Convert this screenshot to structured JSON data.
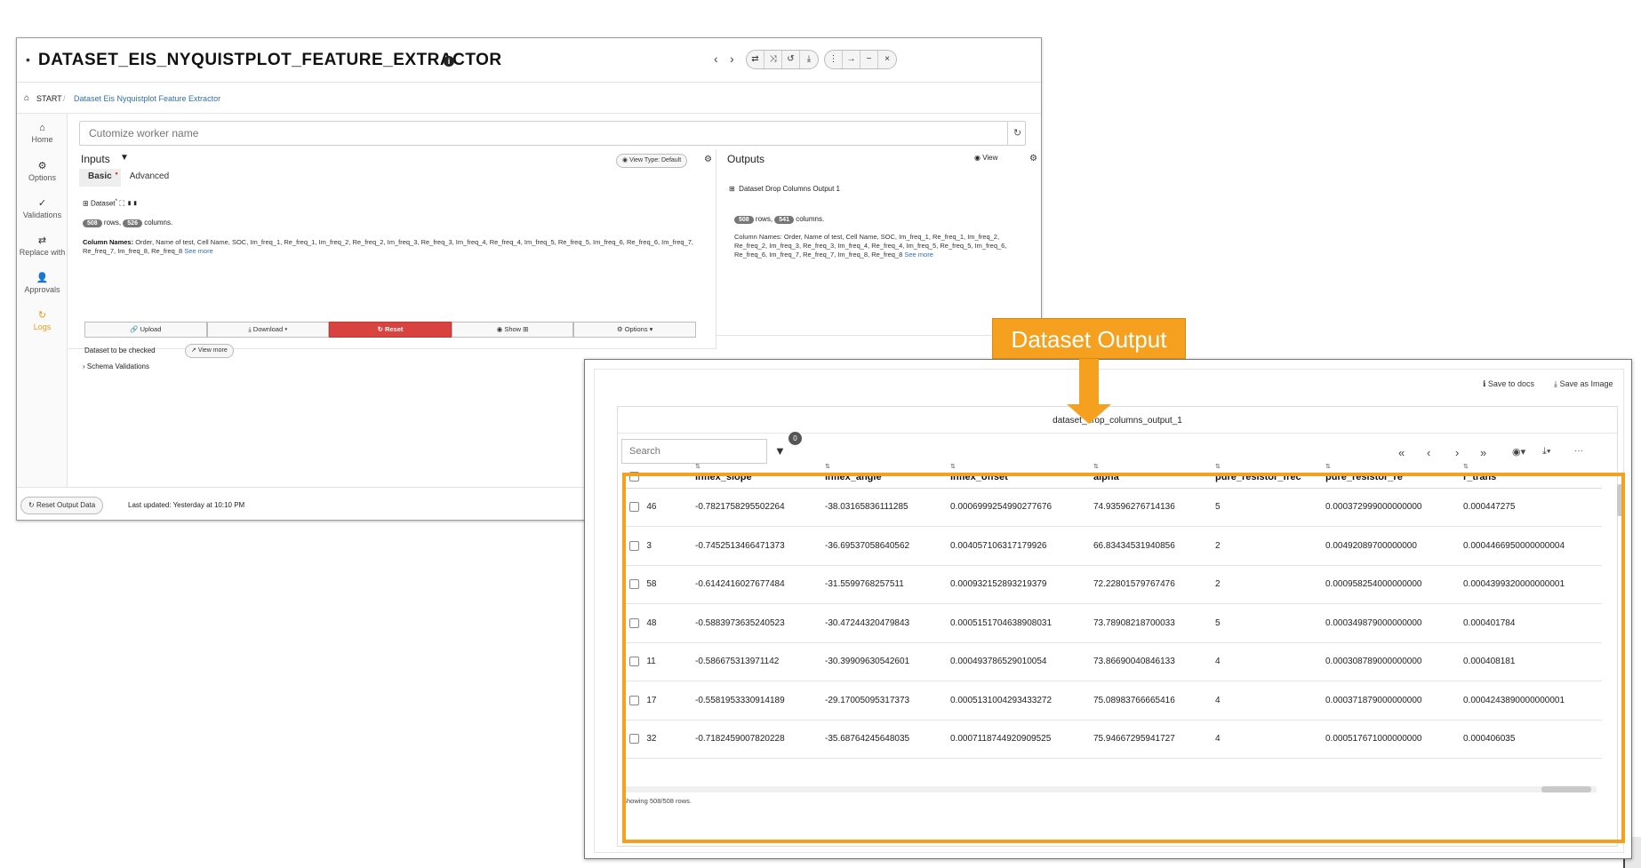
{
  "window": {
    "title": "DATASET_EIS_NYQUISTPLOT_FEATURE_EXTRACTOR",
    "nav_back": "‹",
    "nav_forward": "›"
  },
  "breadcrumb": {
    "start": "START",
    "separator": "/",
    "current": "Dataset Eis Nyquistplot Feature Extractor"
  },
  "sidebar": {
    "items": [
      {
        "label": "Home",
        "icon": "home-icon"
      },
      {
        "label": "Options",
        "icon": "gear-icon"
      },
      {
        "label": "Validations",
        "icon": "validations-icon"
      },
      {
        "label": "Replace with",
        "icon": "swap-icon"
      },
      {
        "label": "Approvals",
        "icon": "approvals-icon"
      },
      {
        "label": "Logs",
        "icon": "history-icon"
      }
    ]
  },
  "worker": {
    "placeholder": "Cutomize worker name"
  },
  "inputs": {
    "title": "Inputs",
    "view_type": "View Type: Default",
    "tabs": {
      "basic": "Basic",
      "advanced": "Advanced"
    },
    "dataset_label": "Dataset",
    "rows_count": "508",
    "rows_label": "rows,",
    "cols_count": "526",
    "cols_label": "columns.",
    "colnames_label": "Column Names:",
    "colnames_text": "Order, Name of test, Cell Name, SOC, Im_freq_1, Re_freq_1, Im_freq_2, Re_freq_2, Im_freq_3, Re_freq_3, Im_freq_4, Re_freq_4, Im_freq_5, Re_freq_5, Im_freq_6, Re_freq_6, Im_freq_7, Re_freq_7, Im_freq_8, Re_freq_8",
    "see_more": "See more",
    "actions": {
      "upload": "Upload",
      "download": "Download ▾",
      "reset": "Reset",
      "show": "Show",
      "options": "Options ▾"
    },
    "to_check": "Dataset to be checked",
    "view_more": "View more",
    "schema": "Schema Validations"
  },
  "outputs": {
    "title": "Outputs",
    "view": "View",
    "output_name": "Dataset Drop Columns Output 1",
    "rows_count": "508",
    "rows_label": "rows,",
    "cols_count": "541",
    "cols_label": "columns.",
    "colnames_label": "Column Names:",
    "colnames_text": "Order, Name of test, Cell Name, SOC, Im_freq_1, Re_freq_1, Im_freq_2, Re_freq_2, Im_freq_3, Re_freq_3, Im_freq_4, Re_freq_4, Im_freq_5, Re_freq_5, Im_freq_6, Re_freq_6, Im_freq_7, Re_freq_7, Im_freq_8, Re_freq_8",
    "see_more": "See more"
  },
  "footer": {
    "reset_output": "Reset Output Data",
    "updated": "Last updated: Yesterday at 10:10 PM"
  },
  "annotation": {
    "label": "Dataset Output"
  },
  "output_view": {
    "save_docs": "Save to docs",
    "save_image": "Save as Image",
    "table_title": "dataset_drop_columns_output_1",
    "search_placeholder": "Search",
    "filter_count": "0",
    "pager": {
      "first": "«",
      "prev": "‹",
      "next": "›",
      "last": "»",
      "more": "···"
    },
    "columns": [
      "inflex_slope",
      "inflex_angle",
      "inflex_offset",
      "alpha",
      "pure_resistor_frec",
      "pure_resistor_re",
      "r_trans"
    ],
    "rows": [
      {
        "id": "46",
        "cells": [
          "-0.7821758295502264",
          "-38.03165836111285",
          "0.0006999254990277676",
          "74.93596276714136",
          "5",
          "0.000372999000000000",
          "0.000447275"
        ]
      },
      {
        "id": "3",
        "cells": [
          "-0.7452513466471373",
          "-36.69537058640562",
          "0.004057106317179926",
          "66.83434531940856",
          "2",
          "0.00492089700000000",
          "0.0004466950000000004"
        ]
      },
      {
        "id": "58",
        "cells": [
          "-0.6142416027677484",
          "-31.5599768257511",
          "0.000932152893219379",
          "72.22801579767476",
          "2",
          "0.000958254000000000",
          "0.0004399320000000001"
        ]
      },
      {
        "id": "48",
        "cells": [
          "-0.5883973635240523",
          "-30.47244320479843",
          "0.0005151704638908031",
          "73.78908218700033",
          "5",
          "0.000349879000000000",
          "0.000401784"
        ]
      },
      {
        "id": "11",
        "cells": [
          "-0.586675313971142",
          "-30.39909630542601",
          "0.000493786529010054",
          "73.86690040846133",
          "4",
          "0.000308789000000000",
          "0.000408181"
        ]
      },
      {
        "id": "17",
        "cells": [
          "-0.5581953330914189",
          "-29.17005095317373",
          "0.0005131004293433272",
          "75.08983766665416",
          "4",
          "0.000371879000000000",
          "0.0004243890000000001"
        ]
      },
      {
        "id": "32",
        "cells": [
          "-0.7182459007820228",
          "-35.68764245648035",
          "0.0007118744920909525",
          "75.94667295941727",
          "4",
          "0.000517671000000000",
          "0.000406035"
        ]
      }
    ],
    "showing": "Showing 508/508 rows."
  }
}
